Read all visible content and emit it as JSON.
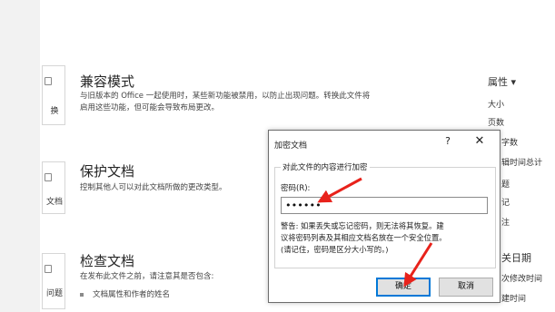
{
  "sections": {
    "compat": {
      "card_label": "换",
      "title": "兼容模式",
      "desc_line1": "与旧版本的 Office 一起使用时，某些新功能被禁用，以防止出现问题。转换此文件将",
      "desc_line2": "启用这些功能，但可能会导致布局更改。"
    },
    "protect": {
      "card_label": "文档",
      "title": "保护文档",
      "desc": "控制其他人可以对此文档所做的更改类型。"
    },
    "inspect": {
      "card_label": "问题",
      "title": "检查文档",
      "desc": "在发布此文件之前，请注意其是否包含:",
      "bullet": "文档属性和作者的姓名"
    }
  },
  "right_panel": {
    "properties": "属性",
    "size": "大小",
    "pages": "页数",
    "words": "字数",
    "edit_time": "辑时间总计",
    "title": "题",
    "tags": "记",
    "comments": "注",
    "related_dates": "关日期",
    "last_modified": "次修改时间",
    "created": "建时间"
  },
  "dialog": {
    "title": "加密文档",
    "help": "?",
    "close": "✕",
    "group_label": "对此文件的内容进行加密",
    "password_label": "密码(R):",
    "password_value": "••••••",
    "warning_line1": "警告: 如果丢失或忘记密码，则无法将其恢复。建",
    "warning_line2": "议将密码列表及其相应文档名放在一个安全位置。",
    "warning_line3": "(请记住，密码是区分大小写的。)",
    "ok_label": "确定",
    "cancel_label": "取消"
  },
  "colors": {
    "arrow": "#e8221b",
    "dialog_border": "#6d6d6d",
    "ok_focus": "#0078d7"
  }
}
